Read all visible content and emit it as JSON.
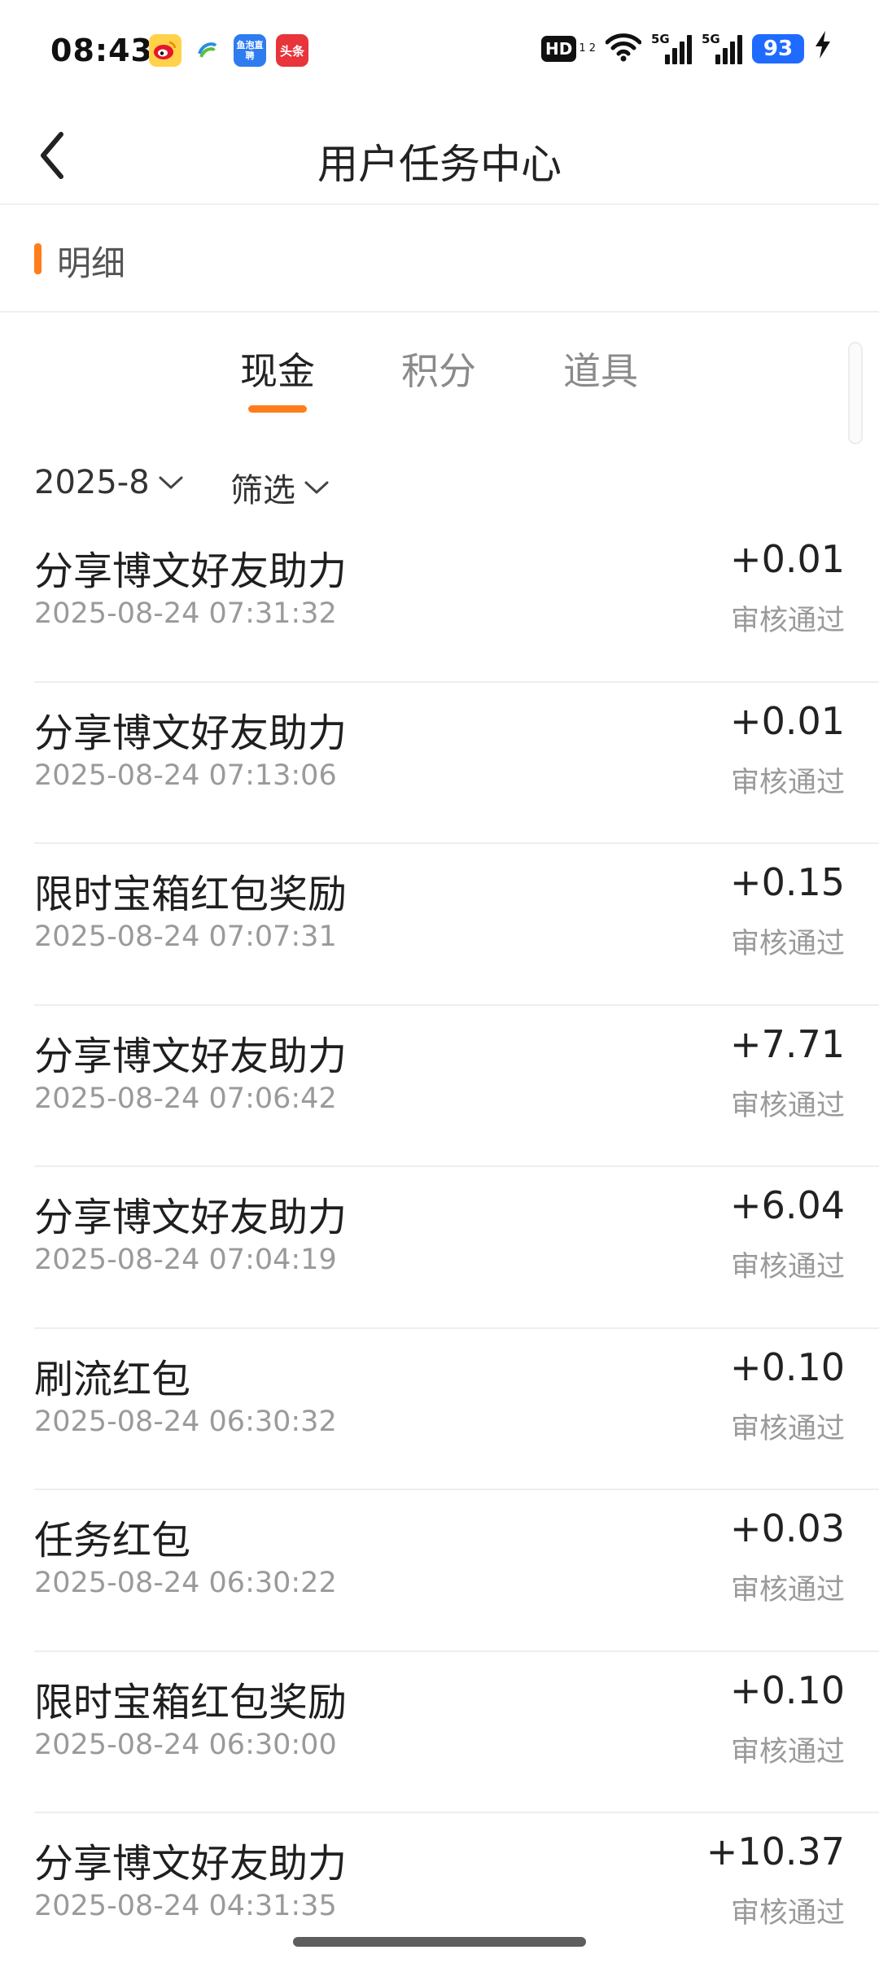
{
  "status_bar": {
    "time": "08:43",
    "notifications": [
      {
        "icon": "weibo-icon",
        "glyph": "◉"
      },
      {
        "icon": "china-mobile-icon",
        "glyph": ""
      },
      {
        "icon": "yupao-live-icon",
        "text": "鱼泡直聘"
      },
      {
        "icon": "toutiao-icon",
        "text": "头条"
      }
    ],
    "hd_label": "HD",
    "hd_sub": "1 2",
    "signal1_label": "5G",
    "signal2_label": "5G",
    "battery": "93"
  },
  "header": {
    "title": "用户任务中心"
  },
  "section": {
    "label": "明细"
  },
  "tabs": [
    {
      "label": "现金",
      "active": true
    },
    {
      "label": "积分",
      "active": false
    },
    {
      "label": "道具",
      "active": false
    }
  ],
  "filters": {
    "month": "2025-8",
    "filter_label": "筛选"
  },
  "accent_color": "#ff7d1a",
  "records": [
    {
      "title": "分享博文好友助力",
      "time": "2025-08-24 07:31:32",
      "amount": "+0.01",
      "status": "审核通过"
    },
    {
      "title": "分享博文好友助力",
      "time": "2025-08-24 07:13:06",
      "amount": "+0.01",
      "status": "审核通过"
    },
    {
      "title": "限时宝箱红包奖励",
      "time": "2025-08-24 07:07:31",
      "amount": "+0.15",
      "status": "审核通过"
    },
    {
      "title": "分享博文好友助力",
      "time": "2025-08-24 07:06:42",
      "amount": "+7.71",
      "status": "审核通过"
    },
    {
      "title": "分享博文好友助力",
      "time": "2025-08-24 07:04:19",
      "amount": "+6.04",
      "status": "审核通过"
    },
    {
      "title": "刷流红包",
      "time": "2025-08-24 06:30:32",
      "amount": "+0.10",
      "status": "审核通过"
    },
    {
      "title": "任务红包",
      "time": "2025-08-24 06:30:22",
      "amount": "+0.03",
      "status": "审核通过"
    },
    {
      "title": "限时宝箱红包奖励",
      "time": "2025-08-24 06:30:00",
      "amount": "+0.10",
      "status": "审核通过"
    },
    {
      "title": "分享博文好友助力",
      "time": "2025-08-24 04:31:35",
      "amount": "+10.37",
      "status": "审核通过"
    }
  ]
}
